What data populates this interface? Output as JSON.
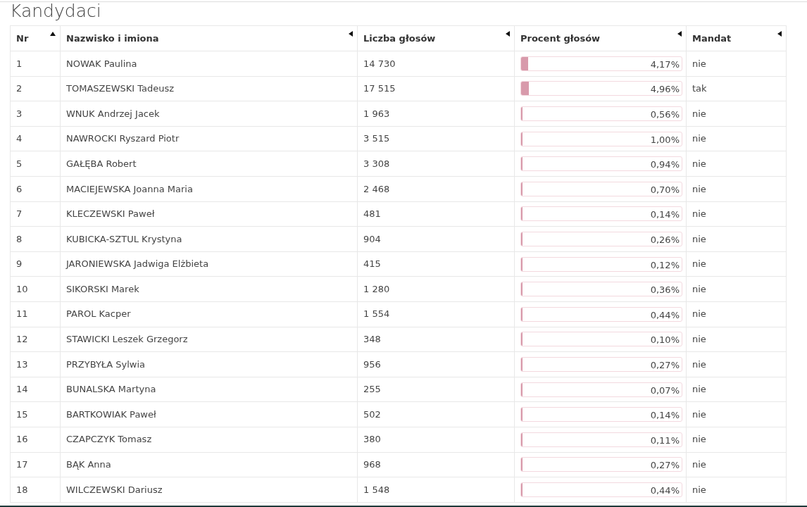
{
  "title": "Kandydaci",
  "table": {
    "columns": [
      {
        "label": "Nr",
        "sorted": true
      },
      {
        "label": "Nazwisko i imiona",
        "sorted": false
      },
      {
        "label": "Liczba głosów",
        "sorted": false
      },
      {
        "label": "Procent głosów",
        "sorted": false
      },
      {
        "label": "Mandat",
        "sorted": false
      }
    ],
    "rows": [
      {
        "nr": "1",
        "name": "NOWAK Paulina",
        "votes": "14 730",
        "percent": "4,17%",
        "level": 0.0417,
        "mandate": "nie"
      },
      {
        "nr": "2",
        "name": "TOMASZEWSKI Tadeusz",
        "votes": "17 515",
        "percent": "4,96%",
        "level": 0.0496,
        "mandate": "tak"
      },
      {
        "nr": "3",
        "name": "WNUK Andrzej Jacek",
        "votes": "1 963",
        "percent": "0,56%",
        "level": 0.0056,
        "mandate": "nie"
      },
      {
        "nr": "4",
        "name": "NAWROCKI Ryszard Piotr",
        "votes": "3 515",
        "percent": "1,00%",
        "level": 0.01,
        "mandate": "nie"
      },
      {
        "nr": "5",
        "name": "GAŁĘBA Robert",
        "votes": "3 308",
        "percent": "0,94%",
        "level": 0.0094,
        "mandate": "nie"
      },
      {
        "nr": "6",
        "name": "MACIEJEWSKA Joanna Maria",
        "votes": "2 468",
        "percent": "0,70%",
        "level": 0.007,
        "mandate": "nie"
      },
      {
        "nr": "7",
        "name": "KLECZEWSKI Paweł",
        "votes": "481",
        "percent": "0,14%",
        "level": 0.0014,
        "mandate": "nie"
      },
      {
        "nr": "8",
        "name": "KUBICKA-SZTUL Krystyna",
        "votes": "904",
        "percent": "0,26%",
        "level": 0.0026,
        "mandate": "nie"
      },
      {
        "nr": "9",
        "name": "JARONIEWSKA Jadwiga Elżbieta",
        "votes": "415",
        "percent": "0,12%",
        "level": 0.0012,
        "mandate": "nie"
      },
      {
        "nr": "10",
        "name": "SIKORSKI Marek",
        "votes": "1 280",
        "percent": "0,36%",
        "level": 0.0036,
        "mandate": "nie"
      },
      {
        "nr": "11",
        "name": "PAROL Kacper",
        "votes": "1 554",
        "percent": "0,44%",
        "level": 0.0044,
        "mandate": "nie"
      },
      {
        "nr": "12",
        "name": "STAWICKI Leszek Grzegorz",
        "votes": "348",
        "percent": "0,10%",
        "level": 0.001,
        "mandate": "nie"
      },
      {
        "nr": "13",
        "name": "PRZYBYŁA Sylwia",
        "votes": "956",
        "percent": "0,27%",
        "level": 0.0027,
        "mandate": "nie"
      },
      {
        "nr": "14",
        "name": "BUNALSKA Martyna",
        "votes": "255",
        "percent": "0,07%",
        "level": 0.0007,
        "mandate": "nie"
      },
      {
        "nr": "15",
        "name": "BARTKOWIAK Paweł",
        "votes": "502",
        "percent": "0,14%",
        "level": 0.0014,
        "mandate": "nie"
      },
      {
        "nr": "16",
        "name": "CZAPCZYK Tomasz",
        "votes": "380",
        "percent": "0,11%",
        "level": 0.0011,
        "mandate": "nie"
      },
      {
        "nr": "17",
        "name": "BĄK Anna",
        "votes": "968",
        "percent": "0,27%",
        "level": 0.0027,
        "mandate": "nie"
      },
      {
        "nr": "18",
        "name": "WILCZEWSKI Dariusz",
        "votes": "1 548",
        "percent": "0,44%",
        "level": 0.0044,
        "mandate": "nie"
      }
    ]
  }
}
